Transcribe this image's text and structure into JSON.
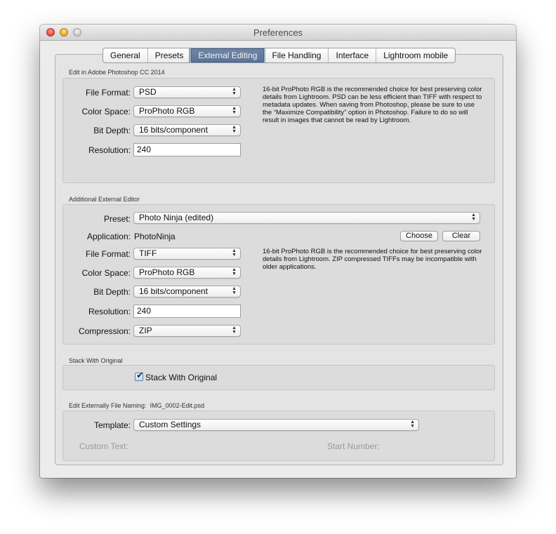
{
  "window": {
    "title": "Preferences"
  },
  "tabs": [
    {
      "label": "General",
      "selected": false
    },
    {
      "label": "Presets",
      "selected": false
    },
    {
      "label": "External Editing",
      "selected": true
    },
    {
      "label": "File Handling",
      "selected": false
    },
    {
      "label": "Interface",
      "selected": false
    },
    {
      "label": "Lightroom mobile",
      "selected": false
    }
  ],
  "photoshop_section": {
    "title": "Edit in Adobe Photoshop CC 2014",
    "file_format_label": "File Format:",
    "file_format_value": "PSD",
    "color_space_label": "Color Space:",
    "color_space_value": "ProPhoto RGB",
    "bit_depth_label": "Bit Depth:",
    "bit_depth_value": "16 bits/component",
    "resolution_label": "Resolution:",
    "resolution_value": "240",
    "description": "16-bit ProPhoto RGB is the recommended choice for best preserving color details from Lightroom. PSD can be less efficient than TIFF with respect to metadata updates. When saving from Photoshop, please be sure to use the “Maximize Compatibility” option in Photoshop. Failure to do so will result in images that cannot be read by Lightroom."
  },
  "additional_section": {
    "title": "Additional External Editor",
    "preset_label": "Preset:",
    "preset_value": "Photo Ninja (edited)",
    "application_label": "Application:",
    "application_value": "PhotoNinja",
    "choose_label": "Choose",
    "clear_label": "Clear",
    "file_format_label": "File Format:",
    "file_format_value": "TIFF",
    "color_space_label": "Color Space:",
    "color_space_value": "ProPhoto RGB",
    "bit_depth_label": "Bit Depth:",
    "bit_depth_value": "16 bits/component",
    "resolution_label": "Resolution:",
    "resolution_value": "240",
    "compression_label": "Compression:",
    "compression_value": "ZIP",
    "description": "16-bit ProPhoto RGB is the recommended choice for best preserving color details from Lightroom. ZIP compressed TIFFs may be incompatible with older applications."
  },
  "stack_section": {
    "title": "Stack With Original",
    "checkbox_label": "Stack With Original",
    "checked": true
  },
  "naming_section": {
    "title": "Edit Externally File Naming:",
    "example": "IMG_0002-Edit.psd",
    "template_label": "Template:",
    "template_value": "Custom Settings",
    "custom_text_label": "Custom Text:",
    "start_number_label": "Start Number:"
  },
  "icons": {
    "popup_arrows": "up-down-arrows-icon",
    "checkmark": "checkmark-icon"
  },
  "colors": {
    "selected_tab": "#5b7294",
    "close": "#e0443a",
    "minimize": "#e3a823",
    "zoom": "#c7c7c7"
  }
}
